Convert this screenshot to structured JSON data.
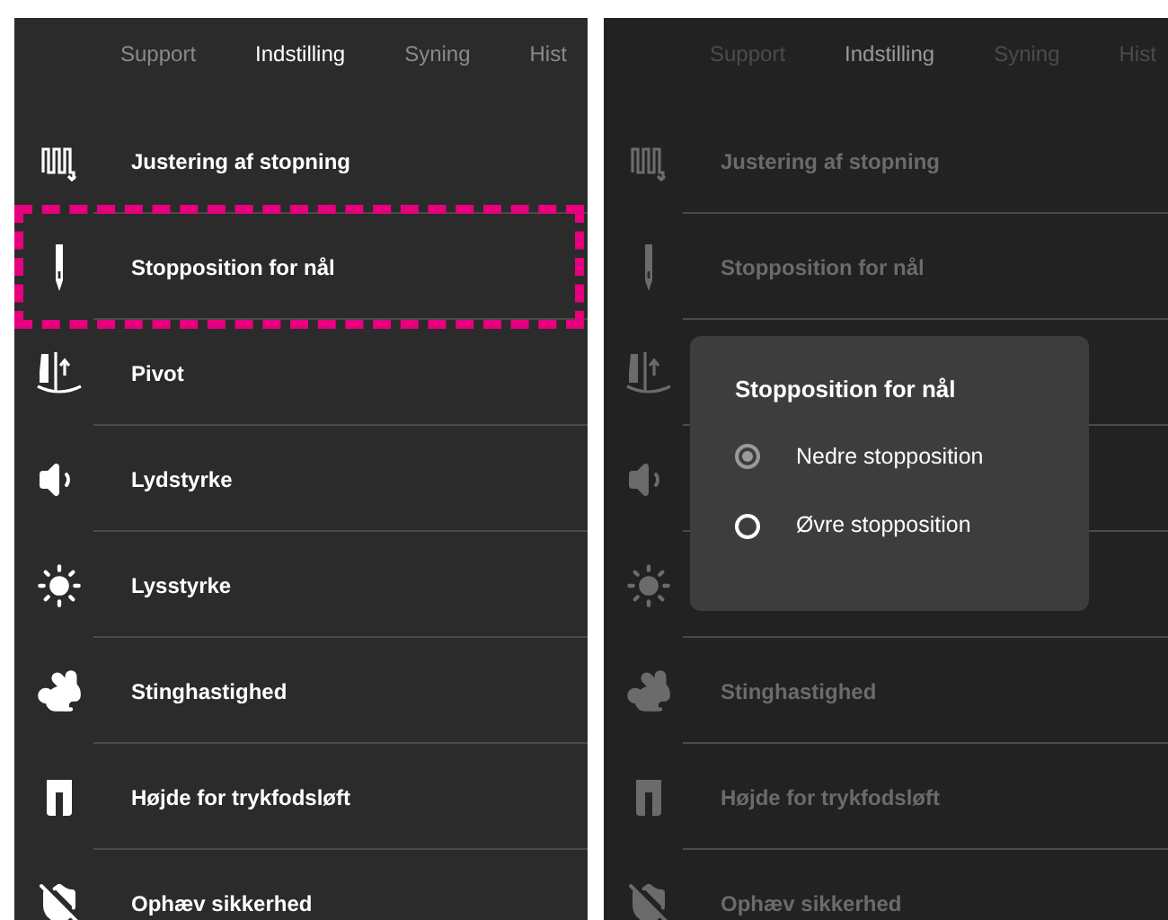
{
  "screens": [
    {
      "dimmed": false,
      "tabs": [
        {
          "label": "Support",
          "selected": false
        },
        {
          "label": "Indstilling",
          "selected": true
        },
        {
          "label": "Syning",
          "selected": false
        },
        {
          "label": "Hist",
          "selected": false
        }
      ],
      "items": [
        {
          "label": "Justering af stopning",
          "highlighted": false
        },
        {
          "label": "Stopposition for nål",
          "highlighted": true
        },
        {
          "label": "Pivot",
          "highlighted": false
        },
        {
          "label": "Lydstyrke",
          "highlighted": false
        },
        {
          "label": "Lysstyrke",
          "highlighted": false
        },
        {
          "label": "Stinghastighed",
          "highlighted": false
        },
        {
          "label": "Højde for trykfodsløft",
          "highlighted": false
        },
        {
          "label": "Ophæv sikkerhed",
          "highlighted": false
        }
      ]
    },
    {
      "dimmed": true,
      "tabs": [
        {
          "label": "Support",
          "selected": false
        },
        {
          "label": "Indstilling",
          "selected": true
        },
        {
          "label": "Syning",
          "selected": false
        },
        {
          "label": "Hist",
          "selected": false
        }
      ],
      "items": [
        {
          "label": "Justering af stopning",
          "highlighted": false
        },
        {
          "label": "Stopposition for nål",
          "highlighted": false
        },
        {
          "highlighted": false
        },
        {
          "highlighted": false
        },
        {
          "highlighted": false
        },
        {
          "label": "Stinghastighed",
          "highlighted": false
        },
        {
          "label": "Højde for trykfodsløft",
          "highlighted": false
        },
        {
          "label": "Ophæv sikkerhed",
          "highlighted": false
        }
      ],
      "dialog": {
        "title": "Stopposition for nål",
        "options": [
          {
            "label": "Nedre stopposition",
            "selected": true
          },
          {
            "label": "Øvre stopposition",
            "selected": false
          }
        ]
      }
    }
  ]
}
